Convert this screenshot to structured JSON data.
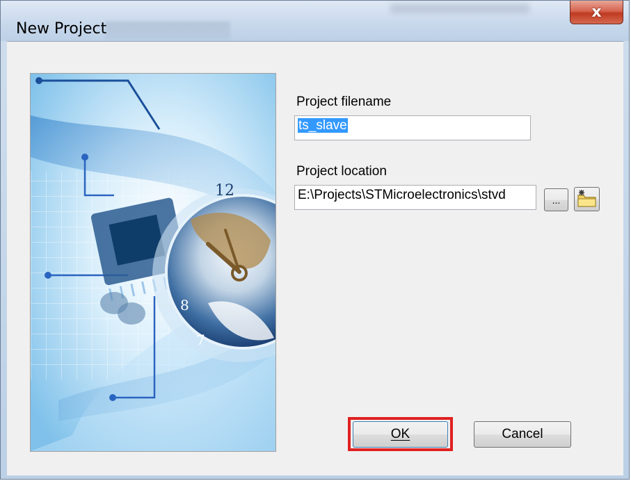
{
  "window": {
    "title": "New Project",
    "close_label": "x"
  },
  "form": {
    "filename_label": "Project filename",
    "filename_value": "ts_slave",
    "location_label": "Project location",
    "location_value": "E:\\Projects\\STMicroelectronics\\stvd",
    "browse_label": "..."
  },
  "buttons": {
    "ok_label": "OK",
    "cancel_label": "Cancel"
  },
  "icons": {
    "close": "close-icon",
    "new_folder": "new-folder-icon",
    "banner": "circuit-globe-clock-illustration"
  },
  "colors": {
    "highlight": "#e02020",
    "selection": "#3399ff"
  }
}
